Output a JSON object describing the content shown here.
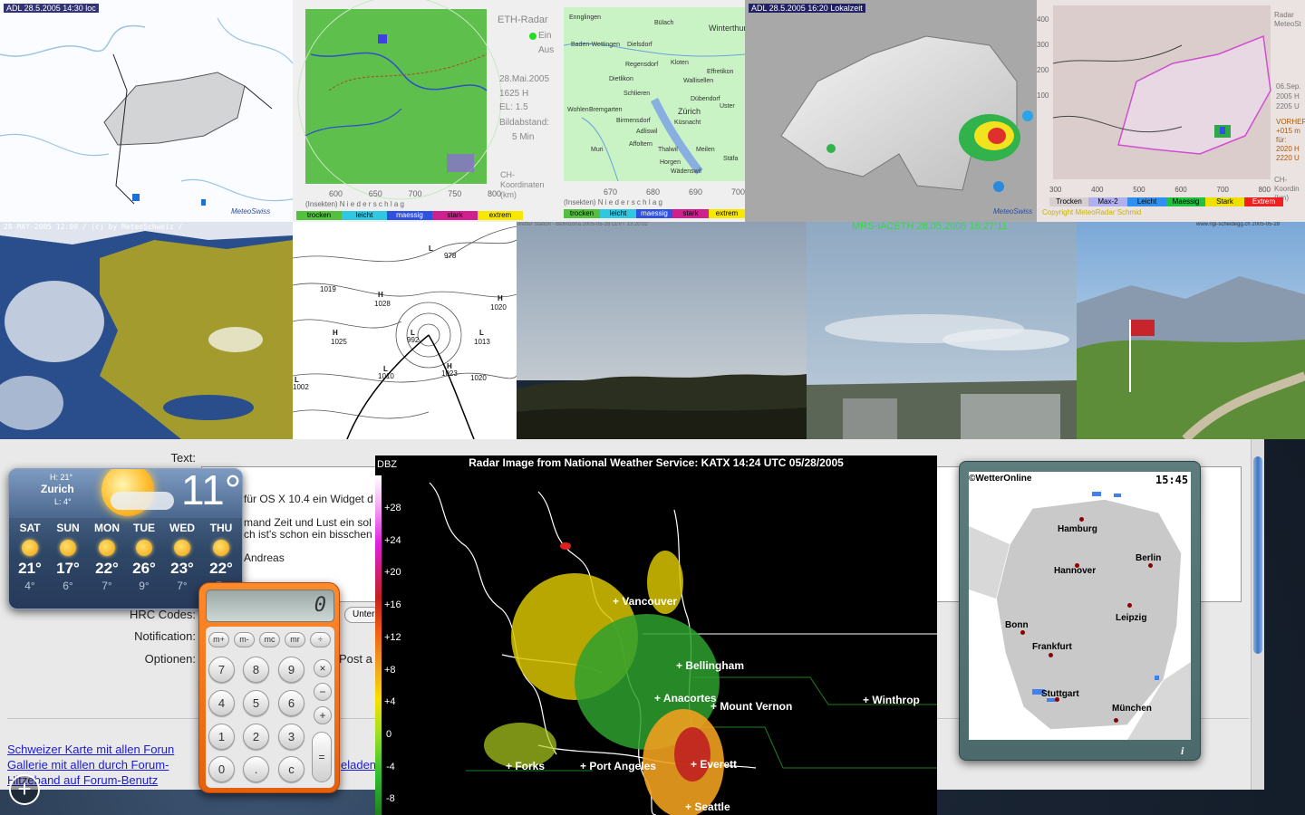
{
  "tiles": {
    "top1_caption": "ADL 28.5.2005 14:30 loc",
    "top1_logo": "MeteoSwiss",
    "eth": {
      "title": "ETH-Radar",
      "on": "Ein",
      "off": "Aus",
      "date": "28.Mai.2005",
      "time": "1625 H",
      "el": "EL: 1.5",
      "interval_label": "Bildabstand:",
      "interval_value": "5 Min",
      "coord_label": "CH-\nKoordinaten\n(km)",
      "axis_label": "(Insekten)  N i e d e r s c h l a g",
      "ticks": [
        "600",
        "650",
        "700",
        "750",
        "800"
      ],
      "legend": [
        "trocken",
        "leicht",
        "maessig",
        "stark",
        "extrem"
      ]
    },
    "zurich": {
      "places": [
        "Ennglingen",
        "Bülach",
        "Winterthur",
        "Baden-Wettingen",
        "Dielsdorf",
        "Regensdorf",
        "Kloten",
        "Dietlikon",
        "Effretikon",
        "Schlieren",
        "Wallisellen",
        "Bremgarten",
        "Zürich",
        "Dübendorf",
        "Wohlen",
        "Birmensdorf",
        "Uster",
        "Adliswil",
        "Küsnacht",
        "Muri",
        "Affoltern",
        "Thalwil",
        "Meilen",
        "Horgen",
        "Wädenswil",
        "Stäfa"
      ],
      "axis_label": "(Insekten)  N i e d e r s c h l a g",
      "ticks": [
        "670",
        "680",
        "690",
        "700"
      ],
      "legend": [
        "trocken",
        "leicht",
        "maessig",
        "stark",
        "extrem"
      ]
    },
    "top4_caption": "ADL 28.5.2005 16:20 Lokalzeit",
    "top4_logo": "MeteoSwiss",
    "meteoradar": {
      "side_top": "Radar\nMeteoSt",
      "side_mid": "06.Sep.\n2005 H\n2205 U",
      "side_fc": "VORHER\n+015 m\nfür:\n2020 H\n2220 U",
      "side_coord": "CH-\nKoordin\n(km)",
      "ticks": [
        "300",
        "400",
        "500",
        "600",
        "700",
        "800"
      ],
      "legend": [
        "Trocken",
        "Max-2",
        "Leicht",
        "Maessig",
        "Stark",
        "Extrem"
      ],
      "copyright": "Copyright MeteoRadar Schmid",
      "y_ticks": [
        "400",
        "300",
        "200",
        "100"
      ]
    },
    "satellite_caption": "28-MAY-2005 12:00 / (c) by MeteoSchweiz /",
    "pressure": {
      "labels": [
        "L",
        "978",
        "1019",
        "H",
        "1028",
        "H",
        "1020",
        "H",
        "1025",
        "L",
        "992",
        "L",
        "1013",
        "L",
        "1010",
        "H",
        "1023",
        "1020",
        "L",
        "1002"
      ]
    },
    "webcam1_caption": "Wetter Station - Bellinzona     2005-05-28 LEVT 13:20:02",
    "webcam2_caption": "MRS-IACETH 28.05.2005 16:27:11",
    "webcam3_caption": "www.rigi-scheidegg.ch     2005-05-28"
  },
  "browser": {
    "text_label": "Text:",
    "body_lines": [
      "für OS X 10.4 ein Widget d",
      "mand Zeit und Lust ein sol",
      "ch ist's schon ein bisschen",
      "Andreas"
    ],
    "hrc_label": "HRC Codes:",
    "hrc_button": "Unter",
    "notification_label": "Notification:",
    "options_label": "Optionen:",
    "options_value": "Post a",
    "links": [
      "Schweizer Karte mit allen Forun",
      "Gallerie mit allen durch Forum-",
      "Hitzeband auf Forum-Benutz"
    ],
    "link_tail": "eladen"
  },
  "weather_widget": {
    "hi": "H: 21°",
    "city": "Zurich",
    "lo": "L: 4°",
    "current_temp": "11°",
    "days": [
      {
        "name": "SAT",
        "hi": "21°",
        "lo": "4°"
      },
      {
        "name": "SUN",
        "hi": "17°",
        "lo": "6°"
      },
      {
        "name": "MON",
        "hi": "22°",
        "lo": "7°"
      },
      {
        "name": "TUE",
        "hi": "26°",
        "lo": "9°"
      },
      {
        "name": "WED",
        "hi": "23°",
        "lo": "7°"
      },
      {
        "name": "THU",
        "hi": "22°",
        "lo": "7°"
      }
    ]
  },
  "calculator": {
    "display": "0",
    "memory_keys": [
      "m+",
      "m-",
      "mc",
      "mr",
      "÷"
    ],
    "digits": [
      "7",
      "8",
      "9",
      "4",
      "5",
      "6",
      "1",
      "2",
      "3",
      "0",
      ".",
      "c"
    ],
    "ops": [
      "×",
      "−",
      "+"
    ],
    "equals": "="
  },
  "radar": {
    "title": "Radar Image from National Weather Service: KATX  14:24 UTC  05/28/2005",
    "scale_title": "DBZ",
    "scale": [
      "+28",
      "+24",
      "+20",
      "+16",
      "+12",
      "+8",
      "+4",
      "0",
      "-4",
      "-8"
    ],
    "cities": [
      "+ Vancouver",
      "+ Bellingham",
      "+ Anacortes",
      "+ Mount Vernon",
      "+ Winthrop",
      "+ Forks",
      "+ Port Angeles",
      "+ Everett",
      "+ Seattle"
    ]
  },
  "wetteronline": {
    "brand": "©WetterOnline",
    "time": "15:45",
    "cities": [
      "Hamburg",
      "Hannover",
      "Berlin",
      "Bonn",
      "Leipzig",
      "Frankfurt",
      "Stuttgart",
      "München"
    ],
    "info": "i"
  },
  "dock": {
    "add_widget": "+"
  },
  "colors": {
    "calc_orange": "#ef6e16",
    "link_blue": "#1b1bd6",
    "radar_bg": "#000000",
    "wetter_frame": "#56767a"
  }
}
